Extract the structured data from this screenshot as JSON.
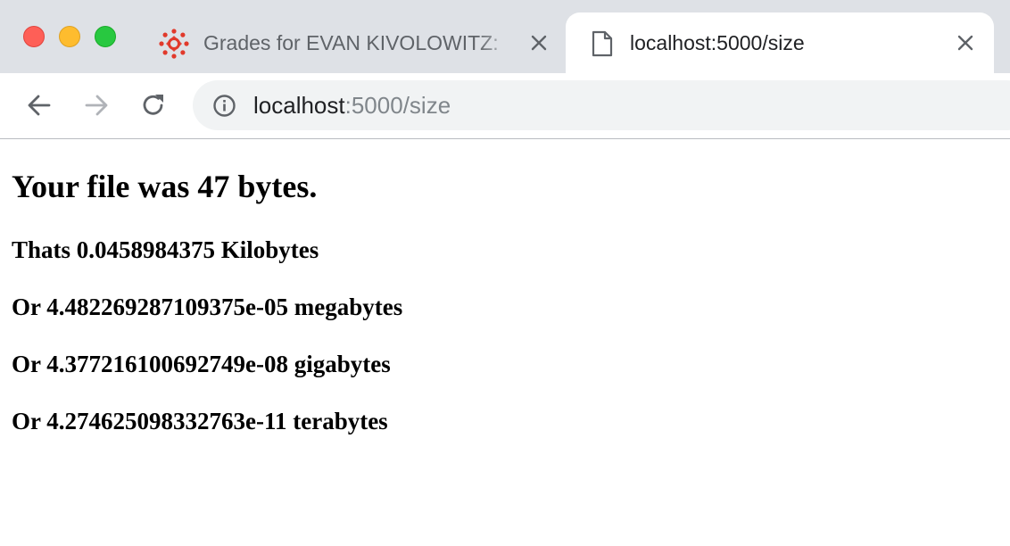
{
  "browser": {
    "tabs": [
      {
        "title": "Grades for EVAN KIVOLOWITZ: ",
        "favicon": "canvas-lms-icon",
        "active": false
      },
      {
        "title": "localhost:5000/size",
        "favicon": "document-icon",
        "active": true
      }
    ],
    "address_bar": {
      "host": "localhost",
      "rest": ":5000/size",
      "security_icon": "info-icon"
    },
    "colors": {
      "tabstrip_bg": "#dee1e6",
      "omnibox_bg": "#f1f3f4",
      "canvas_red": "#e1392b"
    }
  },
  "page": {
    "heading": "Your file was 47 bytes.",
    "lines": [
      "Thats 0.0458984375 Kilobytes",
      "Or 4.482269287109375e-05 megabytes",
      "Or 4.377216100692749e-08 gigabytes",
      "Or 4.274625098332763e-11 terabytes"
    ]
  }
}
